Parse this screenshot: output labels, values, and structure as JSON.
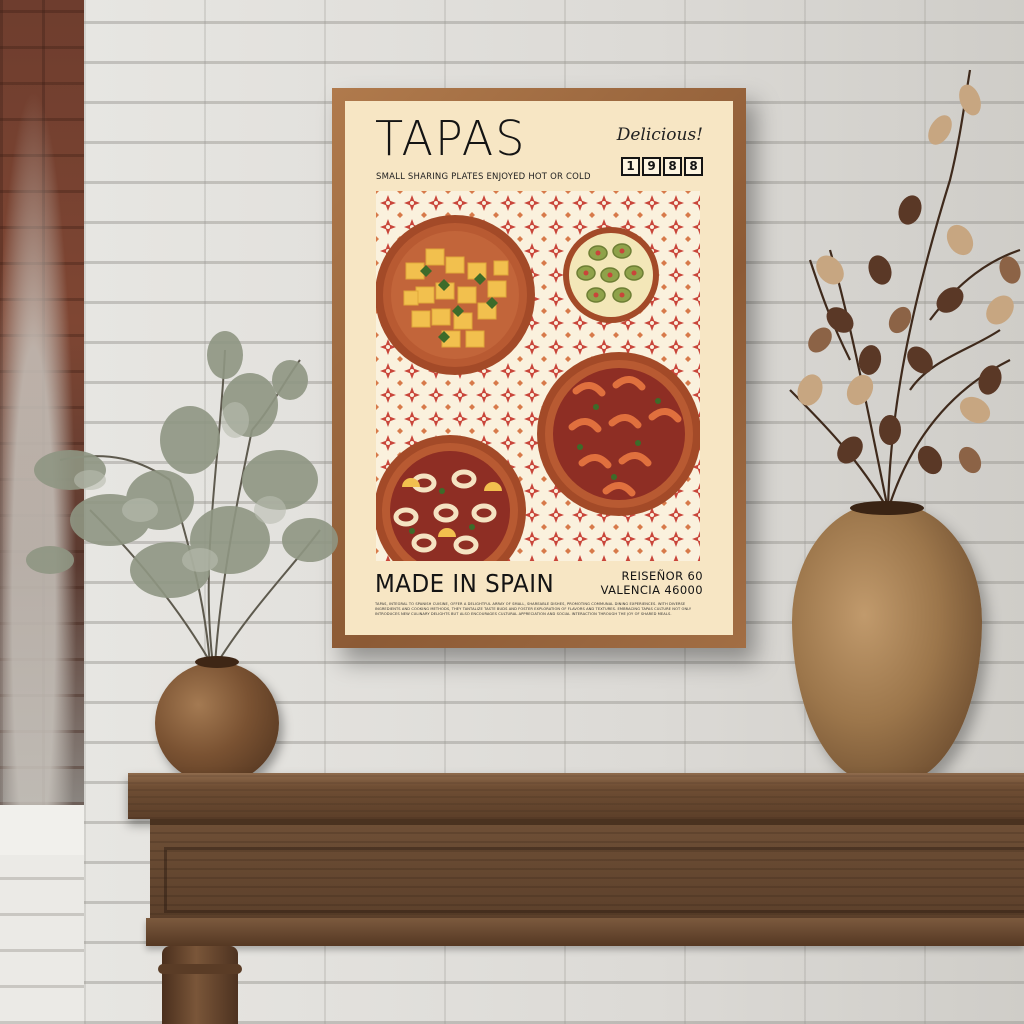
{
  "poster": {
    "title": "TAPAS",
    "subtitle": "SMALL SHARING PLATES ENJOYED HOT OR COLD",
    "tagline": "Delicious!",
    "year_digits": [
      "1",
      "9",
      "8",
      "8"
    ],
    "origin": "MADE IN SPAIN",
    "address_line1": "REISEÑOR 60",
    "address_line2": "VALENCIA 46000",
    "body": "TAPAS, INTEGRAL TO SPANISH CUISINE, OFFER A DELIGHTFUL ARRAY OF SMALL, SHAREABLE DISHES, PROMOTING COMMUNAL DINING EXPERIENCES. WITH DIVERSE INGREDIENTS AND COOKING METHODS, THEY TANTALIZE TASTE BUDS AND FOSTER EXPLORATION OF FLAVORS AND TEXTURES. EMBRACING TAPAS CULTURE NOT ONLY INTRODUCES NEW CULINARY DELIGHTS BUT ALSO ENCOURAGES CULTURAL APPRECIATION AND SOCIAL INTERACTION THROUGH THE JOY OF SHARED MEALS."
  },
  "artwork_dishes": [
    "patatas-bravas",
    "olives",
    "gambas",
    "calamares"
  ],
  "colors": {
    "frame": "#9a6a40",
    "mat": "#f7e6c4",
    "clay_plate": "#b85a32",
    "sauce": "#8e2e24",
    "tile_red": "#c9453a",
    "olive": "#8fa24a",
    "potato": "#f2c04e",
    "wall": "#e2e1dd",
    "shelf": "#6b4a31"
  }
}
